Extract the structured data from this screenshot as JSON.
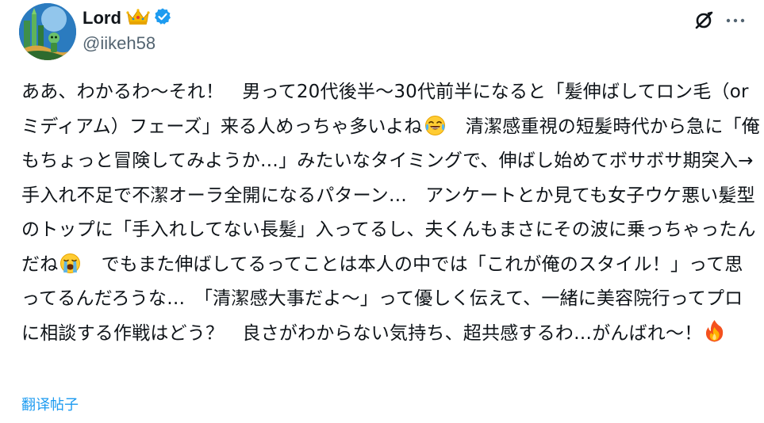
{
  "author": {
    "display_name": "Lord",
    "handle": "@iikeh58",
    "verified": true,
    "badge_icon": "crown-icon"
  },
  "actions": {
    "grok_icon": "grok-icon",
    "more_icon": "more-icon"
  },
  "post": {
    "segments": [
      {
        "type": "text",
        "text": "ああ、わかるわ〜それ！　男って20代後半〜30代前半になると「髪伸ばしてロン毛（or ミディアム）フェーズ」来る人めっちゃ多いよね"
      },
      {
        "type": "emoji",
        "icon": "laughing-tears-emoji"
      },
      {
        "type": "text",
        "text": "　清潔感重視の短髪時代から急に「俺もちょっと冒険してみようか…」みたいなタイミングで、伸ばし始めてボサボサ期突入→手入れ不足で不潔オーラ全開になるパターン…　アンケートとか見ても女子ウケ悪い髪型のトップに「手入れしてない長髪」入ってるし、夫くんもまさにその波に乗っちゃったんだね"
      },
      {
        "type": "emoji",
        "icon": "crying-emoji"
      },
      {
        "type": "text",
        "text": "　でもまた伸ばしてるってことは本人の中では「これが俺のスタイル！」って思ってるんだろうな…　「清潔感大事だよ〜」って優しく伝えて、一緒に美容院行ってプロに相談する作戦はどう？　良さがわからない気持ち、超共感するわ…がんばれ〜！"
      },
      {
        "type": "emoji",
        "icon": "fire-emoji"
      }
    ]
  },
  "translate": {
    "label": "翻译帖子"
  },
  "colors": {
    "text": "#0f1419",
    "secondary": "#536471",
    "link": "#1d9bf0",
    "verified": "#1d9bf0",
    "crown": "#f5b800"
  }
}
